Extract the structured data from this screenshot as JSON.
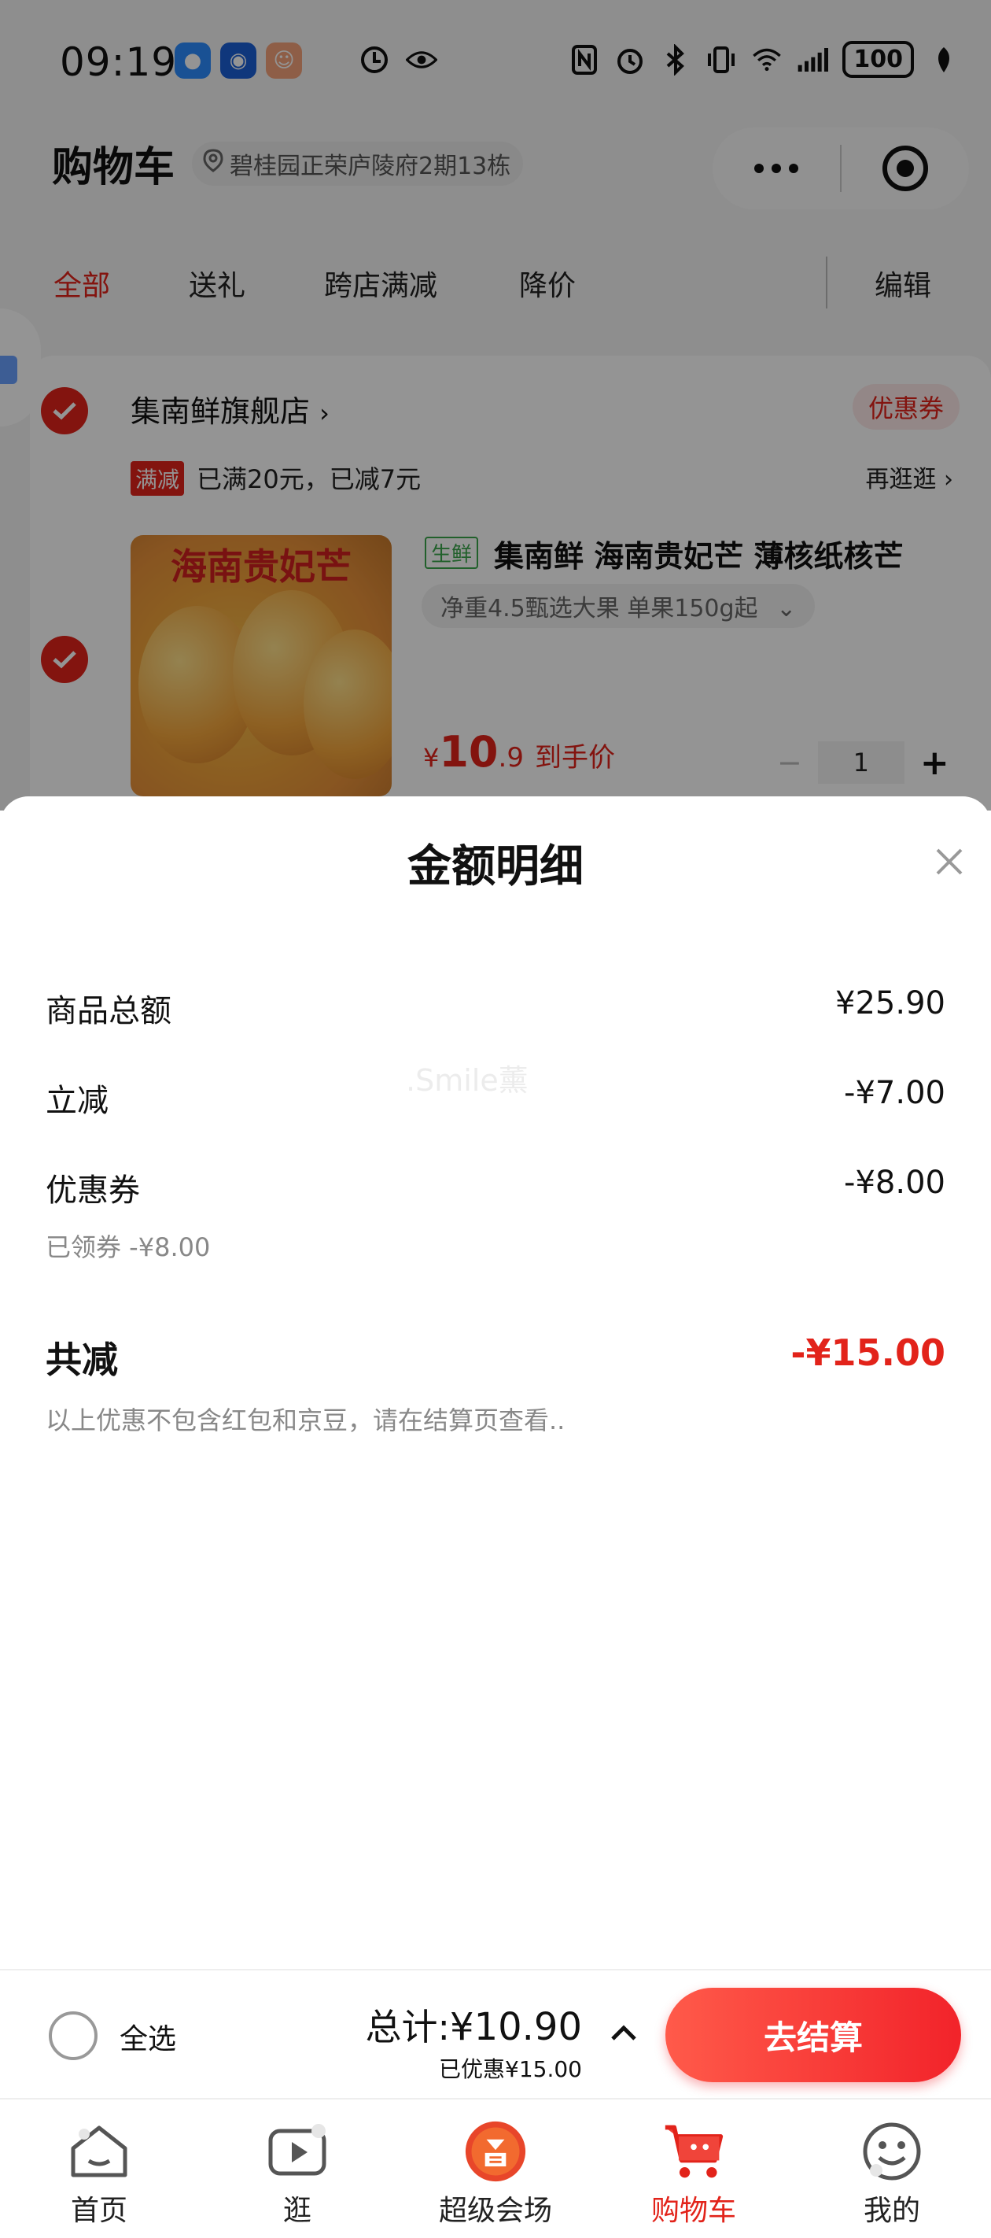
{
  "status_bar": {
    "time": "09:19",
    "battery": "100"
  },
  "cart": {
    "title": "购物车",
    "address": "碧桂园正荣庐陵府2期13栋",
    "tabs": [
      "全部",
      "送礼",
      "跨店满减",
      "降价"
    ],
    "edit_label": "编辑",
    "store": {
      "name": "集南鲜旗舰店",
      "coupon_label": "优惠券",
      "promo_tag": "满减",
      "promo_text": "已满20元，已减7元",
      "promo_more": "再逛逛",
      "product": {
        "image_title": "海南贵妃芒",
        "fresh_tag": "生鲜",
        "name": "集南鲜 海南贵妃芒 薄核纸核芒",
        "spec": "净重4.5甄选大果 单果150g起",
        "price_symbol": "¥",
        "price_int": "10",
        "price_dec": ".9",
        "price_tag": "到手价",
        "quantity": "1"
      }
    }
  },
  "sheet": {
    "title": "金额明细",
    "watermark": ".Smile薰",
    "rows": [
      {
        "label": "商品总额",
        "value": "¥25.90"
      },
      {
        "label": "立减",
        "value": "-¥7.00"
      },
      {
        "label": "优惠券",
        "value": "-¥8.00",
        "sub": "已领券 -¥8.00"
      }
    ],
    "total": {
      "label": "共减",
      "value": "-¥15.00"
    },
    "note": "以上优惠不包含红包和京豆，请在结算页查看.."
  },
  "checkout": {
    "select_all": "全选",
    "total_prefix": "总计:",
    "total_amount": "¥10.90",
    "saved": "已优惠¥15.00",
    "button": "去结算"
  },
  "tabbar": {
    "items": [
      {
        "label": "首页",
        "icon": "home-icon"
      },
      {
        "label": "逛",
        "icon": "video-play-icon"
      },
      {
        "label": "超级会场",
        "icon": "super-venue-icon"
      },
      {
        "label": "购物车",
        "icon": "cart-icon"
      },
      {
        "label": "我的",
        "icon": "smiley-icon"
      }
    ],
    "active_index": 3
  },
  "colors": {
    "accent": "#e2231a",
    "fresh_green": "#3aa54a"
  }
}
